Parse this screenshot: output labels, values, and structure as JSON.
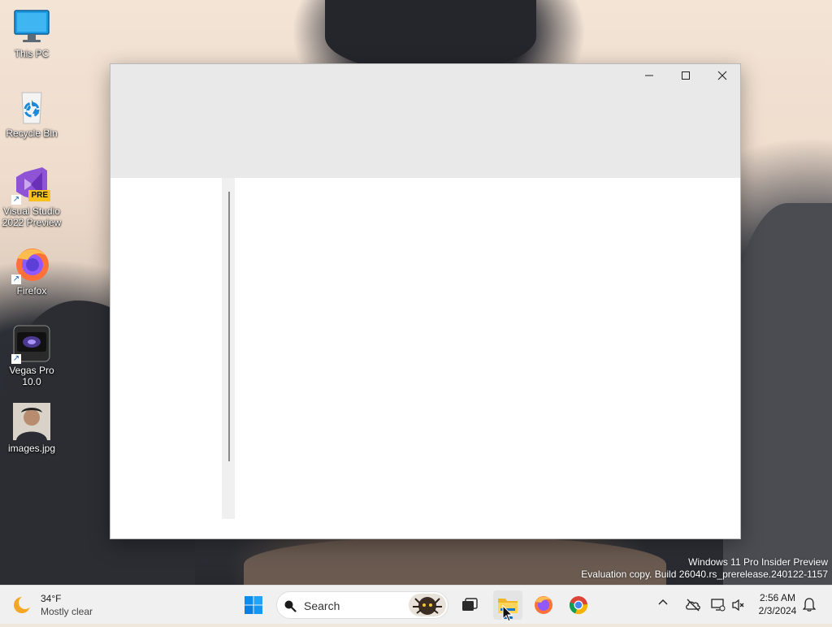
{
  "desktop": {
    "icons": [
      {
        "label": "This PC"
      },
      {
        "label": "Recycle Bin"
      },
      {
        "label": "Visual Studio 2022 Preview",
        "badge": "PRE"
      },
      {
        "label": "Firefox"
      },
      {
        "label": "Vegas Pro 10.0"
      },
      {
        "label": "images.jpg"
      }
    ],
    "watermark": {
      "line1": "Windows 11 Pro Insider Preview",
      "line2": "Evaluation copy. Build 26040.rs_prerelease.240122-1157"
    }
  },
  "window": {
    "controls": {
      "minimize": "minimize-icon",
      "maximize": "maximize-icon",
      "close": "close-icon"
    }
  },
  "taskbar": {
    "weather": {
      "temp": "34°F",
      "condition": "Mostly clear"
    },
    "search": {
      "placeholder": "Search"
    },
    "clock": {
      "time": "2:56 AM",
      "date": "2/3/2024"
    },
    "accent": "#0067c0"
  }
}
